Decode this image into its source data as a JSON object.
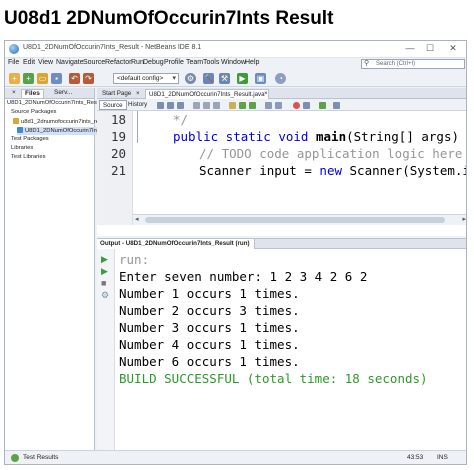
{
  "slide": {
    "title": "U08d1 2DNumOfOccurin7Ints Result"
  },
  "window": {
    "title": "U8D1_2DNumOfOccurin7Ints_Result - NetBeans IDE 8.1",
    "controls": {
      "minimize": "—",
      "maximize": "☐",
      "close": "✕"
    }
  },
  "menubar": {
    "items": [
      "File",
      "Edit",
      "View",
      "Navigate",
      "Source",
      "Refactor",
      "Run",
      "Debug",
      "Profile",
      "Team",
      "Tools",
      "Window",
      "Help"
    ]
  },
  "search": {
    "placeholder": "Search (Ctrl+I)"
  },
  "toolbar": {
    "config_value": "<default config>"
  },
  "left_panel": {
    "tabs": [
      "Files",
      "Serv..."
    ],
    "close_glyph": "×",
    "tree": [
      "U8D1_2DNumOfOccurin7Ints_Result",
      "Source Packages",
      "u8d1_2dnumofoccurin7ints_re",
      "U8D1_2DNumOfOccurin7Ints",
      "Test Packages",
      "Libraries",
      "Test Libraries"
    ]
  },
  "editor": {
    "tabs": [
      "Start Page",
      "U8D1_2DNumOfOccurin7Ints_Result.java"
    ],
    "close_glyph": "×",
    "source_button": "Source",
    "history_button": "History",
    "lines": [
      {
        "no": "18",
        "text": "*/"
      },
      {
        "no": "19",
        "kw1": "public static void ",
        "method": "main",
        "rest": "(String[] args) {"
      },
      {
        "no": "20",
        "text": "// TODO code application logic here"
      },
      {
        "no": "21",
        "plain": "Scanner input = ",
        "kw": "new",
        "rest": " Scanner(System.in"
      }
    ]
  },
  "output": {
    "tab_label": "Output - U8D1_2DNumOfOccurin7Ints_Result (run)",
    "lines": [
      "run:",
      "Enter seven number: 1 2 3 4 2 6 2",
      "Number 1 occurs 1 times.",
      "Number 2 occurs 3 times.",
      "Number 3 occurs 1 times.",
      "Number 4 occurs 1 times.",
      "Number 6 occurs 1 times.",
      "BUILD SUCCESSFUL (total time: 18 seconds)"
    ]
  },
  "statusbar": {
    "left": "Test Results",
    "position": "43:53",
    "mode": "INS"
  },
  "colors": {
    "keyword": "#0000e6",
    "comment": "#969696",
    "success": "#2a9a2a"
  }
}
